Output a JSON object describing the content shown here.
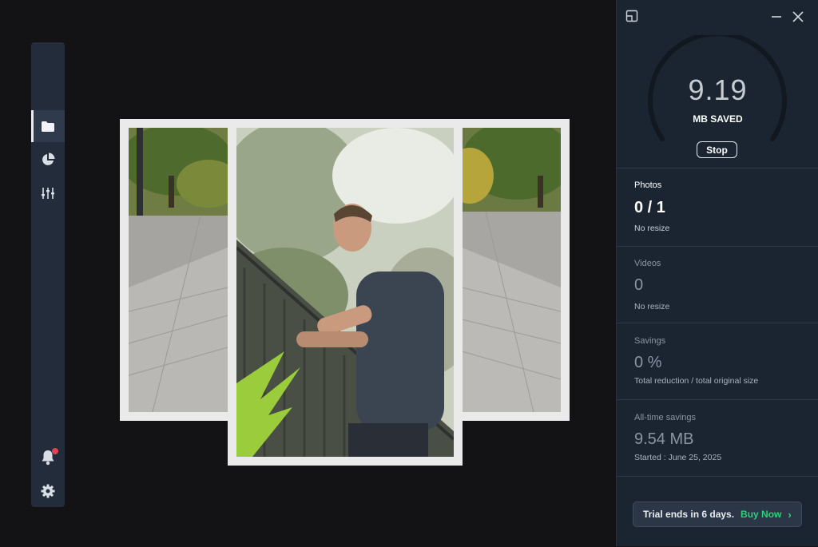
{
  "rail": {
    "items": [
      {
        "icon": "folder-icon",
        "active": true
      },
      {
        "icon": "pie-chart-icon",
        "active": false
      },
      {
        "icon": "sliders-icon",
        "active": false
      }
    ],
    "bottom": [
      {
        "icon": "bell-icon",
        "has_badge": true
      },
      {
        "icon": "gear-icon"
      }
    ]
  },
  "gauge": {
    "value": "9.19",
    "label": "MB SAVED",
    "stop_label": "Stop"
  },
  "photos": {
    "title": "Photos",
    "value": "0 / 1",
    "sub": "No resize"
  },
  "videos": {
    "title": "Videos",
    "value": "0",
    "sub": "No resize"
  },
  "savings": {
    "title": "Savings",
    "value": "0 %",
    "sub": "Total reduction / total original size"
  },
  "alltime": {
    "title": "All-time savings",
    "value": "9.54 MB",
    "sub": "Started : June 25, 2025"
  },
  "trial": {
    "text": "Trial ends in 6 days.",
    "buy": "Buy Now",
    "chevron": "›"
  },
  "window": {
    "restore_icon": "restore-window-icon",
    "minimize_icon": "minimize-icon",
    "close_icon": "close-icon"
  },
  "colors": {
    "panel_bg": "#1b2532",
    "rail_bg": "#222c3a",
    "accent_green": "#2ad27a",
    "badge_red": "#e2434f"
  }
}
